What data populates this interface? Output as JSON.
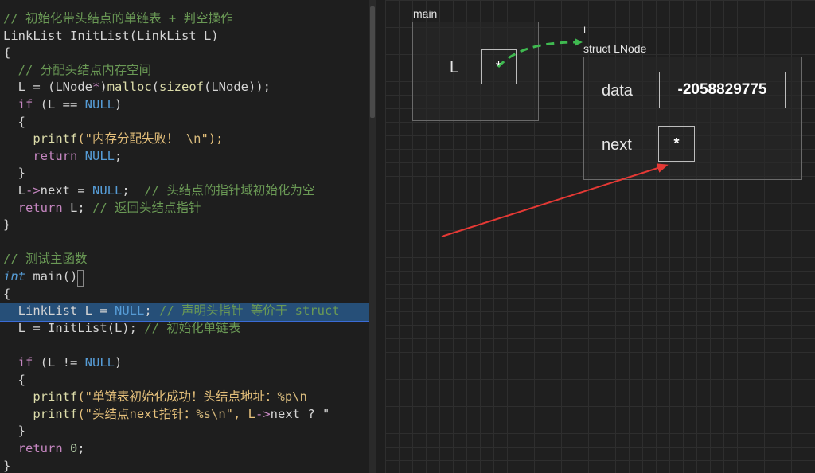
{
  "editor": {
    "lines": [
      [
        {
          "t": "// 初始化带头结点的单链表 + 判空操作",
          "c": "cm"
        }
      ],
      [
        {
          "t": "LinkList InitList(LinkList L)",
          "c": "op"
        }
      ],
      [
        {
          "t": "{",
          "c": "op"
        }
      ],
      [
        {
          "t": "  // 分配头结点内存空间",
          "c": "cm"
        }
      ],
      [
        {
          "t": "  L = (LNode",
          "c": "op"
        },
        {
          "t": "*",
          "c": "ptr"
        },
        {
          "t": ")",
          "c": "op"
        },
        {
          "t": "malloc",
          "c": "fn"
        },
        {
          "t": "(",
          "c": "op"
        },
        {
          "t": "sizeof",
          "c": "fn"
        },
        {
          "t": "(LNode));",
          "c": "op"
        }
      ],
      [
        {
          "t": "  ",
          "c": "op"
        },
        {
          "t": "if",
          "c": "kw"
        },
        {
          "t": " (L == ",
          "c": "op"
        },
        {
          "t": "NULL",
          "c": "ty"
        },
        {
          "t": ")",
          "c": "op"
        }
      ],
      [
        {
          "t": "  {",
          "c": "op"
        }
      ],
      [
        {
          "t": "    ",
          "c": "op"
        },
        {
          "t": "printf",
          "c": "fn"
        },
        {
          "t": "(\"内存分配失败！ ",
          "c": "str-y"
        },
        {
          "t": "\\n",
          "c": "esc"
        },
        {
          "t": "\");",
          "c": "str-y"
        }
      ],
      [
        {
          "t": "    ",
          "c": "op"
        },
        {
          "t": "return",
          "c": "kw"
        },
        {
          "t": " ",
          "c": "op"
        },
        {
          "t": "NULL",
          "c": "ty"
        },
        {
          "t": ";",
          "c": "op"
        }
      ],
      [
        {
          "t": "  }",
          "c": "op"
        }
      ],
      [
        {
          "t": "  L",
          "c": "op"
        },
        {
          "t": "->",
          "c": "ptr"
        },
        {
          "t": "next = ",
          "c": "op"
        },
        {
          "t": "NULL",
          "c": "ty"
        },
        {
          "t": ";  ",
          "c": "op"
        },
        {
          "t": "// 头结点的指针域初始化为空",
          "c": "cm"
        }
      ],
      [
        {
          "t": "  ",
          "c": "op"
        },
        {
          "t": "return",
          "c": "kw"
        },
        {
          "t": " L; ",
          "c": "op"
        },
        {
          "t": "// 返回头结点指针",
          "c": "cm"
        }
      ],
      [
        {
          "t": "}",
          "c": "op"
        }
      ],
      [
        {
          "t": "",
          "c": "op"
        }
      ],
      [
        {
          "t": "// 测试主函数",
          "c": "cm"
        }
      ],
      [
        {
          "t": "int",
          "c": "ty-it"
        },
        {
          "t": " main()",
          "c": "op"
        }
      ],
      [
        {
          "t": "{",
          "c": "op"
        }
      ],
      [
        {
          "t": "  LinkList L = ",
          "c": "op"
        },
        {
          "t": "NULL",
          "c": "ty"
        },
        {
          "t": "; ",
          "c": "op"
        },
        {
          "t": "// 声明头指针 等价于 struct",
          "c": "cm"
        }
      ],
      [
        {
          "t": "  L = InitList(L); ",
          "c": "op"
        },
        {
          "t": "// 初始化单链表",
          "c": "cm"
        }
      ],
      [
        {
          "t": "",
          "c": "op"
        }
      ],
      [
        {
          "t": "  ",
          "c": "op"
        },
        {
          "t": "if",
          "c": "kw"
        },
        {
          "t": " (L != ",
          "c": "op"
        },
        {
          "t": "NULL",
          "c": "ty"
        },
        {
          "t": ")",
          "c": "op"
        }
      ],
      [
        {
          "t": "  {",
          "c": "op"
        }
      ],
      [
        {
          "t": "    ",
          "c": "op"
        },
        {
          "t": "printf",
          "c": "fn"
        },
        {
          "t": "(\"单链表初始化成功！头结点地址：",
          "c": "str-y"
        },
        {
          "t": "%p\\n",
          "c": "esc"
        }
      ],
      [
        {
          "t": "    ",
          "c": "op"
        },
        {
          "t": "printf",
          "c": "fn"
        },
        {
          "t": "(\"头结点next指针：",
          "c": "str-y"
        },
        {
          "t": "%s\\n",
          "c": "esc"
        },
        {
          "t": "\", L",
          "c": "str-y"
        },
        {
          "t": "->",
          "c": "ptr"
        },
        {
          "t": "next ? \"",
          "c": "op"
        }
      ],
      [
        {
          "t": "  }",
          "c": "op"
        }
      ],
      [
        {
          "t": "  ",
          "c": "op"
        },
        {
          "t": "return",
          "c": "kw"
        },
        {
          "t": " ",
          "c": "op"
        },
        {
          "t": "0",
          "c": "num"
        },
        {
          "t": ";",
          "c": "op"
        }
      ],
      [
        {
          "t": "}",
          "c": "op"
        }
      ]
    ]
  },
  "viz": {
    "main_frame": {
      "label": "main",
      "var_name": "L",
      "value": "*"
    },
    "pointer_target_label": "L",
    "struct": {
      "label": "struct LNode",
      "fields": [
        {
          "name": "data",
          "value": "-2058829775"
        },
        {
          "name": "next",
          "value": "*"
        }
      ]
    },
    "colors": {
      "pointer_arrow": "#3fb950",
      "annotation_arrow": "#e53935"
    }
  }
}
